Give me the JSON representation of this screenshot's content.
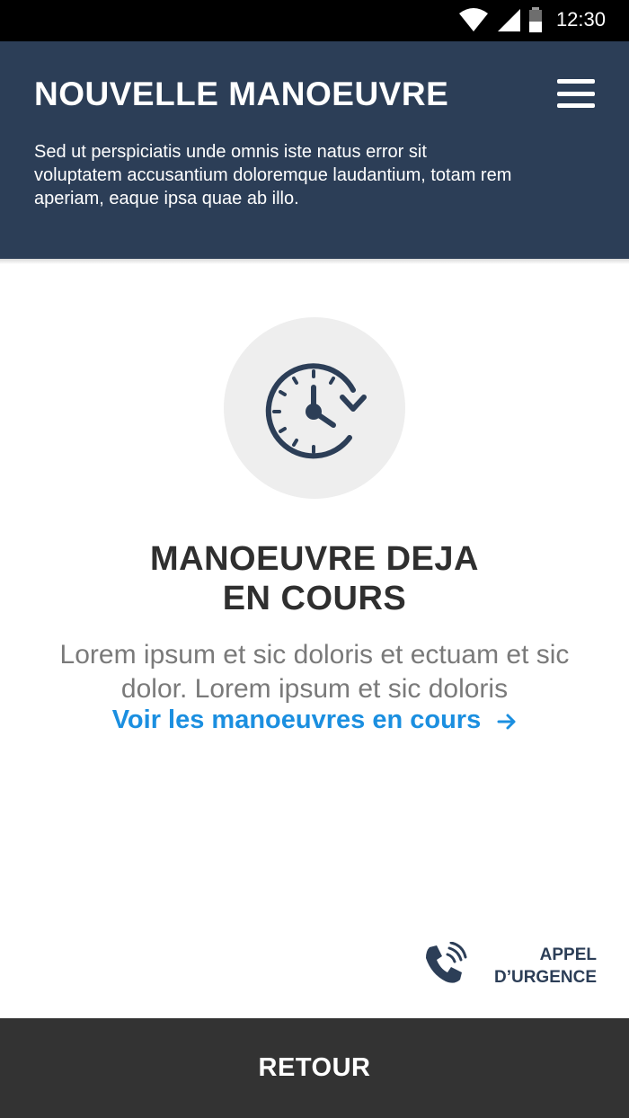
{
  "status_bar": {
    "time": "12:30",
    "icons": [
      "wifi-icon",
      "cell-signal-icon",
      "battery-icon"
    ]
  },
  "header": {
    "title": "NOUVELLE MANOEUVRE",
    "description": "Sed ut perspiciatis unde omnis iste natus error sit voluptatem accusantium doloremque laudantium, totam rem aperiam, eaque ipsa quae ab illo.",
    "menu_icon": "hamburger-menu-icon",
    "background_color": "#2c3e57"
  },
  "main": {
    "icon": "clock-rotate-icon",
    "title_line1": "MANOEUVRE DEJA",
    "title_line2": "EN COURS",
    "description": "Lorem ipsum et sic doloris et ectuam et sic dolor. Lorem ipsum et sic doloris",
    "link_label": "Voir les manoeuvres en cours",
    "link_icon": "arrow-right-icon",
    "link_color": "#1b8fe0"
  },
  "emergency": {
    "icon": "phone-ringing-icon",
    "line1": "APPEL",
    "line2": "D’URGENCE"
  },
  "footer": {
    "button_label": "RETOUR",
    "background_color": "#333333"
  }
}
